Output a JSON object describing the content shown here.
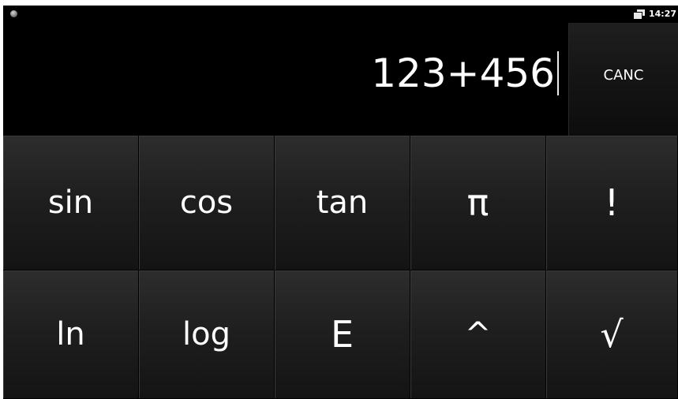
{
  "status_bar": {
    "notification_icon": "dot-icon",
    "screens_icon": "multi-window-icon",
    "time": "14:27"
  },
  "display": {
    "expression": "123+456",
    "clear_label": "CANC"
  },
  "keypad": {
    "rows": [
      [
        {
          "id": "sin",
          "label": "sin"
        },
        {
          "id": "cos",
          "label": "cos"
        },
        {
          "id": "tan",
          "label": "tan"
        },
        {
          "id": "pi",
          "label": "π"
        },
        {
          "id": "factorial",
          "label": "!"
        }
      ],
      [
        {
          "id": "ln",
          "label": "ln"
        },
        {
          "id": "log",
          "label": "log"
        },
        {
          "id": "e",
          "label": "E"
        },
        {
          "id": "power",
          "label": "^"
        },
        {
          "id": "sqrt",
          "label": "√"
        }
      ]
    ]
  },
  "colors": {
    "background": "#000000",
    "key_top": "#2d2d2d",
    "key_bottom": "#141414",
    "text": "#ffffff"
  }
}
